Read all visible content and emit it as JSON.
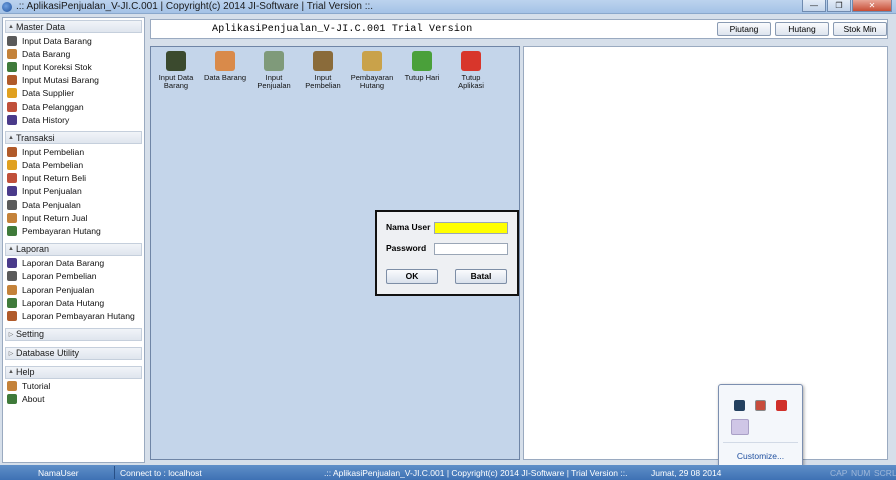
{
  "window": {
    "title": ".:: AplikasiPenjualan_V-JI.C.001  |  Copyright(c) 2014 JI-Software  |  Trial Version ::."
  },
  "header": {
    "app_title": "AplikasiPenjualan_V-JI.C.001 Trial Version",
    "buttons": [
      "Piutang",
      "Hutang",
      "Stok Min"
    ]
  },
  "sidebar": {
    "sections": [
      {
        "title": "Master Data",
        "expanded": true,
        "items": [
          "Input Data Barang",
          "Data Barang",
          "Input Koreksi Stok",
          "Input Mutasi Barang",
          "Data Supplier",
          "Data Pelanggan",
          "Data History"
        ]
      },
      {
        "title": "Transaksi",
        "expanded": true,
        "items": [
          "Input Pembelian",
          "Data Pembelian",
          "Input Return Beli",
          "Input Penjualan",
          "Data Penjualan",
          "Input Return Jual",
          "Pembayaran Hutang"
        ]
      },
      {
        "title": "Laporan",
        "expanded": true,
        "items": [
          "Laporan Data Barang",
          "Laporan Pembelian",
          "Laporan Penjualan",
          "Laporan Data Hutang",
          "Laporan Pembayaran Hutang"
        ]
      },
      {
        "title": "Setting",
        "expanded": false,
        "items": []
      },
      {
        "title": "Database Utility",
        "expanded": false,
        "items": []
      },
      {
        "title": "Help",
        "expanded": true,
        "items": [
          "Tutorial",
          "About"
        ]
      }
    ]
  },
  "toolbar": {
    "items": [
      {
        "label": "Input Data Barang",
        "icon": "input-data-barang-icon",
        "color": "#3b4a2e"
      },
      {
        "label": "Data Barang",
        "icon": "data-barang-icon",
        "color": "#d98a4a"
      },
      {
        "label": "Input Penjualan",
        "icon": "input-penjualan-icon",
        "color": "#7f9a7a"
      },
      {
        "label": "Input Pembelian",
        "icon": "input-pembelian-icon",
        "color": "#8a6b3a"
      },
      {
        "label": "Pembayaran Hutang",
        "icon": "pembayaran-hutang-icon",
        "color": "#c9a24a"
      },
      {
        "label": "Tutup Hari",
        "icon": "tutup-hari-icon",
        "color": "#4aa03a"
      },
      {
        "label": "Tutup Aplikasi",
        "icon": "tutup-aplikasi-icon",
        "color": "#d8362b"
      }
    ]
  },
  "login": {
    "username_label": "Nama User",
    "password_label": "Password",
    "username_value": "",
    "password_value": "",
    "ok_label": "OK",
    "cancel_label": "Batal",
    "username_bg": "#ffff00"
  },
  "tray": {
    "customize_label": "Customize..."
  },
  "statusbar": {
    "user": "NamaUser",
    "connection": "Connect to : localhost",
    "app_info": ".:: AplikasiPenjualan_V-JI.C.001  |  Copyright(c) 2014 JI-Software  |  Trial Version ::.",
    "date": "Jumat, 29 08 2014",
    "caps": "CAP",
    "num": "NUM",
    "scroll": "SCRL"
  }
}
